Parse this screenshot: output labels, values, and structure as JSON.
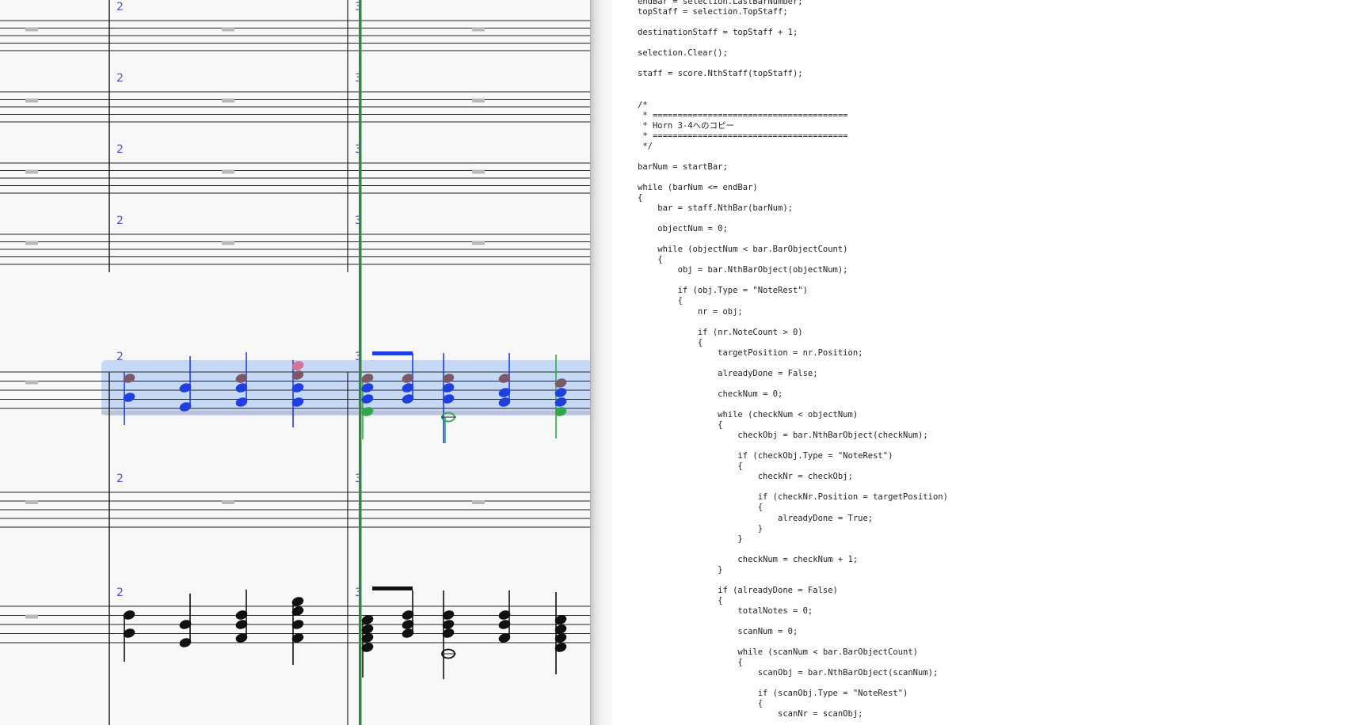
{
  "score": {
    "bar_numbers": [
      "2",
      "3"
    ],
    "accent_colors": {
      "playback_line": "#2e8b3e",
      "selection": "#bcd3f6",
      "selected_notes": "#1f3fe0",
      "bar_number": "#4b52c8",
      "existing_notes": "#7a5a6a",
      "added_notes": "#2ea84a"
    }
  },
  "editor": {
    "lines": [
      "endBar = selection.LastBarNumber;",
      "topStaff = selection.TopStaff;",
      "",
      "destinationStaff = topStaff + 1;",
      "",
      "selection.Clear();",
      "",
      "staff = score.NthStaff(topStaff);",
      "",
      "",
      "/*",
      " * =======================================",
      " * Horn 3-4へのコピー",
      " * =======================================",
      " */",
      "",
      "barNum = startBar;",
      "",
      "while (barNum <= endBar)",
      "{",
      "    bar = staff.NthBar(barNum);",
      "",
      "    objectNum = 0;",
      "",
      "    while (objectNum < bar.BarObjectCount)",
      "    {",
      "        obj = bar.NthBarObject(objectNum);",
      "",
      "        if (obj.Type = \"NoteRest\")",
      "        {",
      "            nr = obj;",
      "",
      "            if (nr.NoteCount > 0)",
      "            {",
      "                targetPosition = nr.Position;",
      "",
      "                alreadyDone = False;",
      "",
      "                checkNum = 0;",
      "",
      "                while (checkNum < objectNum)",
      "                {",
      "                    checkObj = bar.NthBarObject(checkNum);",
      "",
      "                    if (checkObj.Type = \"NoteRest\")",
      "                    {",
      "                        checkNr = checkObj;",
      "",
      "                        if (checkNr.Position = targetPosition)",
      "                        {",
      "                            alreadyDone = True;",
      "                        }",
      "                    }",
      "",
      "                    checkNum = checkNum + 1;",
      "                }",
      "",
      "                if (alreadyDone = False)",
      "                {",
      "                    totalNotes = 0;",
      "",
      "                    scanNum = 0;",
      "",
      "                    while (scanNum < bar.BarObjectCount)",
      "                    {",
      "                        scanObj = bar.NthBarObject(scanNum);",
      "",
      "                        if (scanObj.Type = \"NoteRest\")",
      "                        {",
      "                            scanNr = scanObj;"
    ]
  }
}
